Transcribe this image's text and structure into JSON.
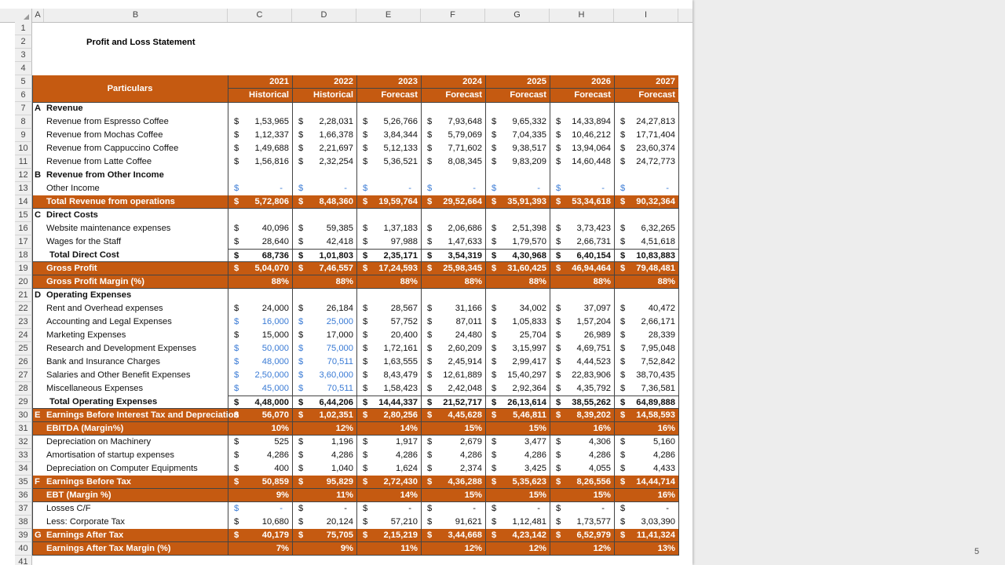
{
  "column_headers": [
    "A",
    "B",
    "C",
    "D",
    "E",
    "F",
    "G",
    "H",
    "I"
  ],
  "row_numbers": [
    "1",
    "2",
    "3",
    "4",
    "5",
    "6",
    "7",
    "8",
    "9",
    "10",
    "11",
    "12",
    "13",
    "14",
    "15",
    "16",
    "17",
    "18",
    "19",
    "20",
    "21",
    "22",
    "23",
    "24",
    "25",
    "26",
    "27",
    "28",
    "29",
    "30",
    "31",
    "32",
    "33",
    "34",
    "35",
    "36",
    "37",
    "38",
    "39",
    "40",
    "41"
  ],
  "title": "Profit and Loss Statement",
  "particulars_header": "Particulars",
  "years": [
    "2021",
    "2022",
    "2023",
    "2024",
    "2025",
    "2026",
    "2027"
  ],
  "types": [
    "Historical",
    "Historical",
    "Forecast",
    "Forecast",
    "Forecast",
    "Forecast",
    "Forecast"
  ],
  "currency": "$",
  "page_number": "5",
  "colors": {
    "accent": "#c55a11",
    "input_blue": "#3a7bd5"
  },
  "rows": [
    {
      "letter": "A",
      "label": "Revenue",
      "kind": "section",
      "values": []
    },
    {
      "letter": "",
      "label": "Revenue from Espresso Coffee",
      "kind": "line",
      "values": [
        "1,53,965",
        "2,28,031",
        "5,26,766",
        "7,93,648",
        "9,65,332",
        "14,33,894",
        "24,27,813"
      ]
    },
    {
      "letter": "",
      "label": "Revenue from Mochas Coffee",
      "kind": "line",
      "values": [
        "1,12,337",
        "1,66,378",
        "3,84,344",
        "5,79,069",
        "7,04,335",
        "10,46,212",
        "17,71,404"
      ]
    },
    {
      "letter": "",
      "label": "Revenue from Cappuccino Coffee",
      "kind": "line",
      "values": [
        "1,49,688",
        "2,21,697",
        "5,12,133",
        "7,71,602",
        "9,38,517",
        "13,94,064",
        "23,60,374"
      ]
    },
    {
      "letter": "",
      "label": "Revenue from Latte Coffee",
      "kind": "line",
      "values": [
        "1,56,816",
        "2,32,254",
        "5,36,521",
        "8,08,345",
        "9,83,209",
        "14,60,448",
        "24,72,773"
      ]
    },
    {
      "letter": "B",
      "label": "Revenue from Other Income",
      "kind": "section",
      "values": []
    },
    {
      "letter": "",
      "label": "Other Income",
      "kind": "line",
      "values": [
        "-",
        "-",
        "-",
        "-",
        "-",
        "-",
        "-"
      ],
      "blue": [
        1,
        1,
        1,
        1,
        1,
        1,
        1
      ]
    },
    {
      "letter": "",
      "label": "Total Revenue from operations",
      "kind": "orange",
      "values": [
        "5,72,806",
        "8,48,360",
        "19,59,764",
        "29,52,664",
        "35,91,393",
        "53,34,618",
        "90,32,364"
      ]
    },
    {
      "letter": "C",
      "label": "Direct Costs",
      "kind": "section",
      "values": []
    },
    {
      "letter": "",
      "label": "Website maintenance expenses",
      "kind": "line",
      "values": [
        "40,096",
        "59,385",
        "1,37,183",
        "2,06,686",
        "2,51,398",
        "3,73,423",
        "6,32,265"
      ]
    },
    {
      "letter": "",
      "label": "Wages for the Staff",
      "kind": "line",
      "values": [
        "28,640",
        "42,418",
        "97,988",
        "1,47,633",
        "1,79,570",
        "2,66,731",
        "4,51,618"
      ]
    },
    {
      "letter": "",
      "label": "Total Direct Cost",
      "kind": "total",
      "values": [
        "68,736",
        "1,01,803",
        "2,35,171",
        "3,54,319",
        "4,30,968",
        "6,40,154",
        "10,83,883"
      ]
    },
    {
      "letter": "",
      "label": "Gross Profit",
      "kind": "orange",
      "values": [
        "5,04,070",
        "7,46,557",
        "17,24,593",
        "25,98,345",
        "31,60,425",
        "46,94,464",
        "79,48,481"
      ]
    },
    {
      "letter": "",
      "label": "Gross Profit Margin (%)",
      "kind": "orange_pct",
      "values": [
        "88%",
        "88%",
        "88%",
        "88%",
        "88%",
        "88%",
        "88%"
      ]
    },
    {
      "letter": "D",
      "label": "Operating Expenses",
      "kind": "section",
      "values": []
    },
    {
      "letter": "",
      "label": "Rent and Overhead expenses",
      "kind": "line",
      "values": [
        "24,000",
        "26,184",
        "28,567",
        "31,166",
        "34,002",
        "37,097",
        "40,472"
      ]
    },
    {
      "letter": "",
      "label": "Accounting and Legal Expenses",
      "kind": "line",
      "values": [
        "16,000",
        "25,000",
        "57,752",
        "87,011",
        "1,05,833",
        "1,57,204",
        "2,66,171"
      ],
      "blue": [
        1,
        1,
        0,
        0,
        0,
        0,
        0
      ]
    },
    {
      "letter": "",
      "label": "Marketing Expenses",
      "kind": "line",
      "values": [
        "15,000",
        "17,000",
        "20,400",
        "24,480",
        "25,704",
        "26,989",
        "28,339"
      ]
    },
    {
      "letter": "",
      "label": "Research and Development Expenses",
      "kind": "line",
      "values": [
        "50,000",
        "75,000",
        "1,72,161",
        "2,60,209",
        "3,15,997",
        "4,69,751",
        "7,95,048"
      ],
      "blue": [
        1,
        1,
        0,
        0,
        0,
        0,
        0
      ]
    },
    {
      "letter": "",
      "label": "Bank and Insurance Charges",
      "kind": "line",
      "values": [
        "48,000",
        "70,511",
        "1,63,555",
        "2,45,914",
        "2,99,417",
        "4,44,523",
        "7,52,842"
      ],
      "blue": [
        1,
        1,
        0,
        0,
        0,
        0,
        0
      ]
    },
    {
      "letter": "",
      "label": "Salaries and Other Benefit Expenses",
      "kind": "line",
      "values": [
        "2,50,000",
        "3,60,000",
        "8,43,479",
        "12,61,889",
        "15,40,297",
        "22,83,906",
        "38,70,435"
      ],
      "blue": [
        1,
        1,
        0,
        0,
        0,
        0,
        0
      ]
    },
    {
      "letter": "",
      "label": "Miscellaneous Expenses",
      "kind": "line",
      "values": [
        "45,000",
        "70,511",
        "1,58,423",
        "2,42,048",
        "2,92,364",
        "4,35,792",
        "7,36,581"
      ],
      "blue": [
        1,
        1,
        0,
        0,
        0,
        0,
        0
      ]
    },
    {
      "letter": "",
      "label": "Total Operating Expenses",
      "kind": "total",
      "values": [
        "4,48,000",
        "6,44,206",
        "14,44,337",
        "21,52,717",
        "26,13,614",
        "38,55,262",
        "64,89,888"
      ]
    },
    {
      "letter": "E",
      "label": "Earnings Before Interest Tax and Depreciation",
      "kind": "orange",
      "values": [
        "56,070",
        "1,02,351",
        "2,80,256",
        "4,45,628",
        "5,46,811",
        "8,39,202",
        "14,58,593"
      ]
    },
    {
      "letter": "",
      "label": "EBITDA (Margin%)",
      "kind": "orange_pct",
      "values": [
        "10%",
        "12%",
        "14%",
        "15%",
        "15%",
        "16%",
        "16%"
      ]
    },
    {
      "letter": "",
      "label": "Depreciation on Machinery",
      "kind": "line",
      "values": [
        "525",
        "1,196",
        "1,917",
        "2,679",
        "3,477",
        "4,306",
        "5,160"
      ]
    },
    {
      "letter": "",
      "label": "Amortisation of startup expenses",
      "kind": "line",
      "values": [
        "4,286",
        "4,286",
        "4,286",
        "4,286",
        "4,286",
        "4,286",
        "4,286"
      ]
    },
    {
      "letter": "",
      "label": "Depreciation on Computer Equipments",
      "kind": "line",
      "values": [
        "400",
        "1,040",
        "1,624",
        "2,374",
        "3,425",
        "4,055",
        "4,433"
      ]
    },
    {
      "letter": "F",
      "label": "Earnings Before Tax",
      "kind": "orange",
      "values": [
        "50,859",
        "95,829",
        "2,72,430",
        "4,36,288",
        "5,35,623",
        "8,26,556",
        "14,44,714"
      ]
    },
    {
      "letter": "",
      "label": "EBT (Margin %)",
      "kind": "orange_pct",
      "values": [
        "9%",
        "11%",
        "14%",
        "15%",
        "15%",
        "15%",
        "16%"
      ]
    },
    {
      "letter": "",
      "label": "Losses C/F",
      "kind": "line",
      "values": [
        "-",
        "-",
        "-",
        "-",
        "-",
        "-",
        "-"
      ],
      "blue": [
        1,
        0,
        0,
        0,
        0,
        0,
        0
      ]
    },
    {
      "letter": "",
      "label": "Less: Corporate Tax",
      "kind": "line",
      "values": [
        "10,680",
        "20,124",
        "57,210",
        "91,621",
        "1,12,481",
        "1,73,577",
        "3,03,390"
      ]
    },
    {
      "letter": "G",
      "label": "Earnings After Tax",
      "kind": "orange",
      "values": [
        "40,179",
        "75,705",
        "2,15,219",
        "3,44,668",
        "4,23,142",
        "6,52,979",
        "11,41,324"
      ]
    },
    {
      "letter": "",
      "label": "Earnings After Tax Margin (%)",
      "kind": "orange_pct",
      "values": [
        "7%",
        "9%",
        "11%",
        "12%",
        "12%",
        "12%",
        "13%"
      ]
    }
  ]
}
